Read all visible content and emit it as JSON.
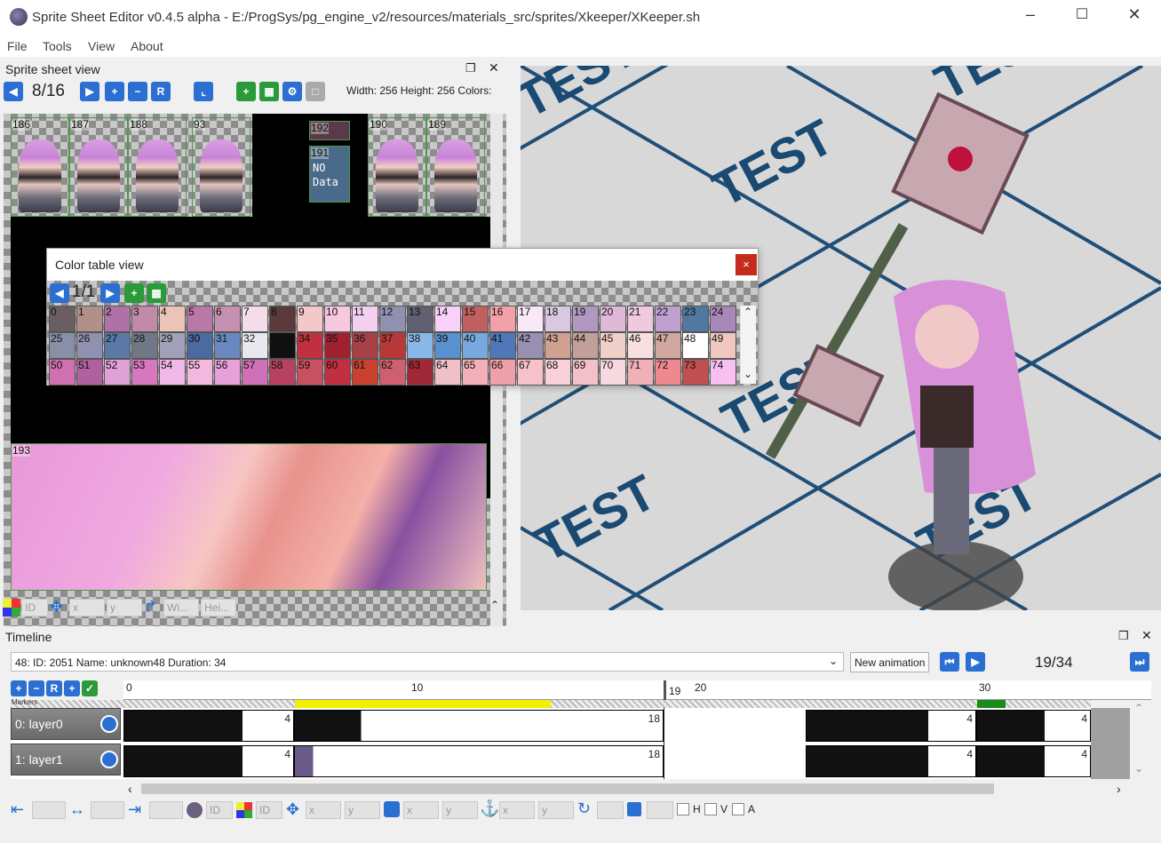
{
  "window": {
    "title": "Sprite Sheet Editor v0.4.5 alpha - E:/ProgSys/pg_engine_v2/resources/materials_src/sprites/Xkeeper/XKeeper.sh"
  },
  "menu": [
    "File",
    "Tools",
    "View",
    "About"
  ],
  "sprite_sheet": {
    "title": "Sprite sheet view",
    "page": "8/16",
    "info": "Width: 256 Height: 256 Colors:",
    "sprites": [
      "186",
      "187",
      "188",
      "93",
      "192",
      "191",
      "190",
      "189",
      "193"
    ],
    "no_data": "NO Data",
    "bottom": {
      "id": "ID",
      "x": "x",
      "y": "y",
      "w": "Wi...",
      "h": "Hei..."
    }
  },
  "color_table": {
    "title": "Color table view",
    "page": "1/1",
    "close": "×",
    "row1": [
      "0",
      "1",
      "2",
      "3",
      "4",
      "5",
      "6",
      "7",
      "8",
      "9",
      "10",
      "11",
      "12",
      "13",
      "14",
      "15",
      "16",
      "17",
      "18",
      "19",
      "20",
      "21",
      "22",
      "23",
      "24"
    ],
    "row2": [
      "25",
      "26",
      "27",
      "28",
      "29",
      "30",
      "31",
      "32",
      "33",
      "34",
      "35",
      "36",
      "37",
      "38",
      "39",
      "40",
      "41",
      "42",
      "43",
      "44",
      "45",
      "46",
      "47",
      "48",
      "49"
    ],
    "row3": [
      "50",
      "51",
      "52",
      "53",
      "54",
      "55",
      "56",
      "57",
      "58",
      "59",
      "60",
      "61",
      "62",
      "63",
      "64",
      "65",
      "66",
      "67",
      "68",
      "69",
      "70",
      "71",
      "72",
      "73",
      "74"
    ],
    "colors1": [
      "#6a5e62",
      "#b09088",
      "#b070a8",
      "#c08aa8",
      "#ecc4b8",
      "#b878a8",
      "#c890b0",
      "#f4dce8",
      "#5a3a3a",
      "#f4c8c8",
      "#f8c8e0",
      "#f4d0f0",
      "#9090b0",
      "#606070",
      "#f8d0f8",
      "#c06060",
      "#f4a0a8",
      "#f8e8f8",
      "#d8c8e0",
      "#b098c0",
      "#e0b8d8",
      "#f0c8e0",
      "#c0a0d0",
      "#5078a0",
      "#a888b8"
    ],
    "colors2": [
      "#8890a8",
      "#9090b0",
      "#5a78a8",
      "#707888",
      "#a0a0b8",
      "#4a6aa0",
      "#6a88c0",
      "#e8e8f0",
      "#101010",
      "#c03040",
      "#a02030",
      "#a84048",
      "#b83838",
      "#88b8e8",
      "#5890d0",
      "#78a8e0",
      "#5078b8",
      "#9890b0",
      "#d0a090",
      "#c0a098",
      "#f0d0c8",
      "#f8e0e0",
      "#d0a8a0",
      "#ffffff",
      "#f0c8c0"
    ],
    "colors3": [
      "#d070b0",
      "#b060a0",
      "#e0a0d8",
      "#d878c0",
      "#f0b8e8",
      "#f4b8e0",
      "#e8a0d8",
      "#d070b8",
      "#b84060",
      "#c85060",
      "#c03040",
      "#c84030",
      "#d06070",
      "#a02838",
      "#f0c0c8",
      "#f4b0b8",
      "#f0a0a8",
      "#f8c0c8",
      "#f8d0d8",
      "#f4c0c8",
      "#f8d8e0",
      "#f0b0b8",
      "#f08890",
      "#c05050",
      "#f8c0f0"
    ]
  },
  "preview": {
    "labels": [
      "TEST",
      "TEST",
      "TEST",
      "TEST",
      "TEST",
      "TEST"
    ]
  },
  "timeline": {
    "title": "Timeline",
    "selector": "48: ID: 2051 Name: unknown48 Duration: 34",
    "new_animation": "New animation",
    "frame_counter": "19/34",
    "ruler": [
      "0",
      "10",
      "19",
      "20",
      "30"
    ],
    "markers_label": "Markers",
    "layers": [
      {
        "name": "0: layer0",
        "frames": [
          "4",
          "18",
          "4",
          "4"
        ]
      },
      {
        "name": "1: layer1",
        "frames": [
          "4",
          "18",
          "4",
          "4"
        ]
      }
    ],
    "bottom": {
      "id1": "ID",
      "id2": "ID",
      "x1": "x",
      "y1": "y",
      "x2": "x",
      "y2": "y",
      "x3": "x",
      "y3": "y",
      "h": "H",
      "v": "V",
      "a": "A"
    }
  }
}
